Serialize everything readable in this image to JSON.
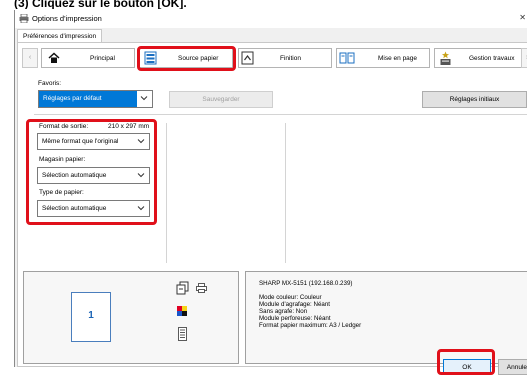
{
  "heading": "(3) Cliquez sur le bouton [OK].",
  "window": {
    "title": "Options d'impression",
    "close_glyph": "✕"
  },
  "tabs": [
    {
      "label": "Préférences d'impression"
    }
  ],
  "nav": {
    "prev_glyph": "‹",
    "next_glyph": "›",
    "items": [
      {
        "label": "Principal",
        "icon": "home-icon"
      },
      {
        "label": "Source papier",
        "icon": "paper-source-icon",
        "highlighted": true
      },
      {
        "label": "Finition",
        "icon": "finishing-icon"
      },
      {
        "label": "Mise en page",
        "icon": "layout-icon"
      },
      {
        "label": "Gestion travaux",
        "icon": "job-handling-icon"
      }
    ]
  },
  "favorites": {
    "label": "Favoris:",
    "value": "Réglages par défaut",
    "save_label": "Sauvegarder",
    "defaults_label": "Réglages initiaux"
  },
  "settings": {
    "output_size": {
      "label": "Format de sortie:",
      "size_text": "210 x 297 mm",
      "value": "Même format que l'original"
    },
    "paper_tray": {
      "label": "Magasin papier:",
      "value": "Sélection automatique"
    },
    "paper_type": {
      "label": "Type de papier:",
      "value": "Sélection automatique"
    }
  },
  "preview": {
    "page_number": "1"
  },
  "printer_info": {
    "name": "SHARP MX-5151 (192.168.0.239)",
    "lines": [
      "Mode couleur: Couleur",
      "Module d'agrafage: Néant",
      "Sans agrafe: Non",
      "Module perforeuse: Néant",
      "Format papier maximum: A3 / Ledger"
    ]
  },
  "footer": {
    "ok_label": "OK",
    "cancel_label": "Annuler"
  },
  "colors": {
    "accent": "#0078d7",
    "highlight_red": "#e0101a"
  }
}
